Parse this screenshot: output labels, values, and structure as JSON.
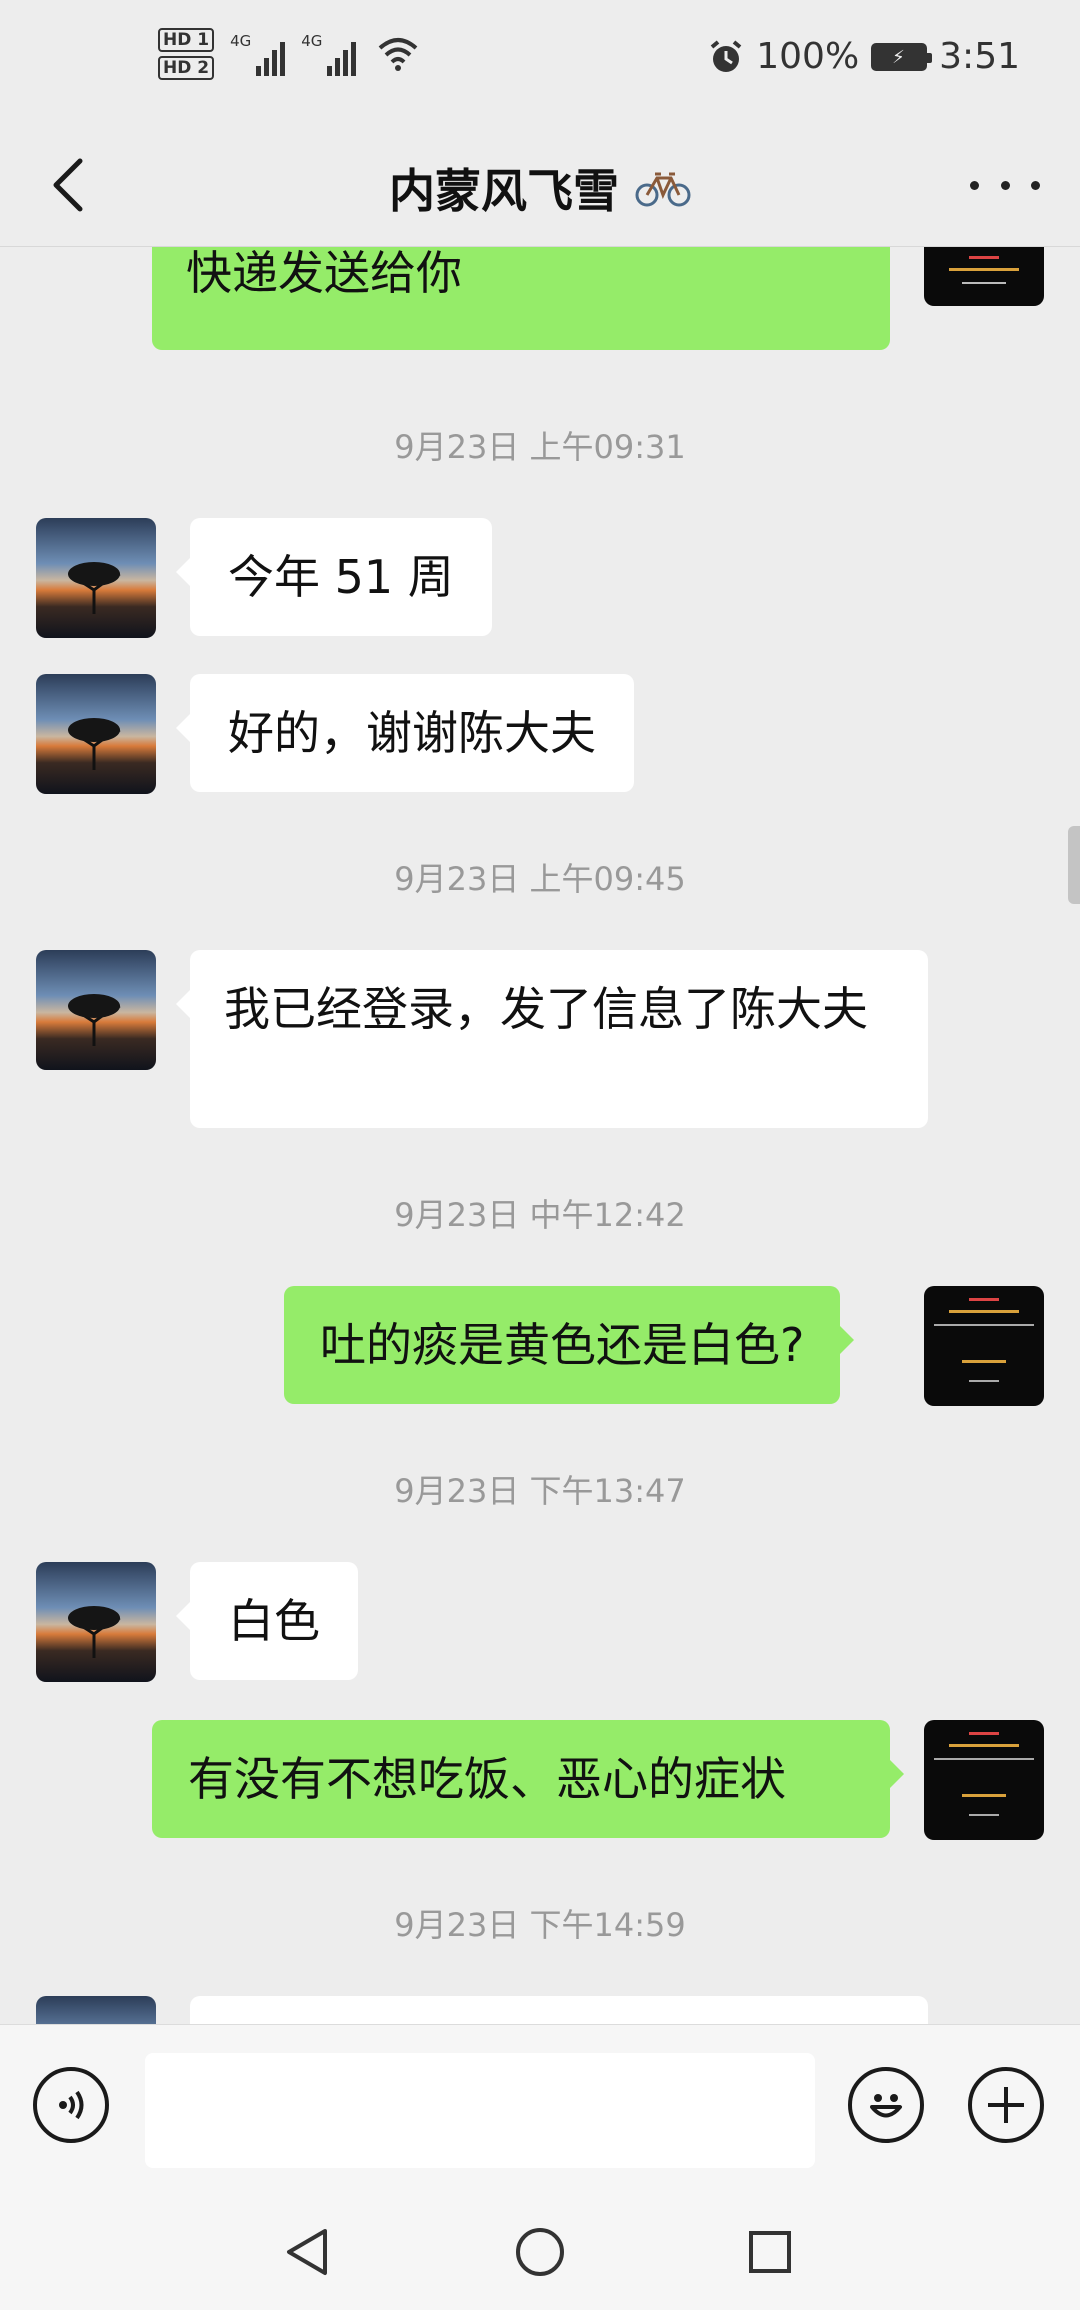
{
  "status_bar": {
    "sim1": "HD 1",
    "sim2": "HD 2",
    "network1": "4G",
    "network2": "4G",
    "battery": "100%",
    "time": "3:51",
    "icons": [
      "alarm-icon",
      "wifi-icon",
      "signal-icon",
      "battery-icon"
    ]
  },
  "header": {
    "title": "内蒙风飞雪",
    "title_icon": "bicycle-icon",
    "back_icon": "back-chevron-icon",
    "more_icon": "more-dots-icon"
  },
  "messages": [
    {
      "type": "text",
      "side": "out",
      "text": "看病后，药物经过百草医生平台快递发送给你"
    },
    {
      "type": "timestamp",
      "text": "9月23日 上午09:31"
    },
    {
      "type": "text",
      "side": "in",
      "text": "今年 51 周"
    },
    {
      "type": "text",
      "side": "in",
      "text": "好的，谢谢陈大夫"
    },
    {
      "type": "timestamp",
      "text": "9月23日 上午09:45"
    },
    {
      "type": "text",
      "side": "in",
      "text": "我已经登录，发了信息了陈大夫"
    },
    {
      "type": "timestamp",
      "text": "9月23日 中午12:42"
    },
    {
      "type": "text",
      "side": "out",
      "text": "吐的痰是黄色还是白色?"
    },
    {
      "type": "timestamp",
      "text": "9月23日 下午13:47"
    },
    {
      "type": "text",
      "side": "in",
      "text": "白色"
    },
    {
      "type": "text",
      "side": "out",
      "text": "有没有不想吃饭、恶心的症状"
    },
    {
      "type": "timestamp",
      "text": "9月23日 下午14:59"
    },
    {
      "type": "text",
      "side": "in",
      "text": ""
    }
  ],
  "input_bar": {
    "value": "",
    "placeholder": "",
    "voice_icon": "voice-icon",
    "emoji_icon": "emoji-icon",
    "plus_icon": "plus-icon"
  },
  "nav_bar": {
    "icons": [
      "nav-back-icon",
      "nav-home-icon",
      "nav-recents-icon"
    ]
  },
  "colors": {
    "background": "#ededed",
    "outgoing_bubble": "#95ec69",
    "incoming_bubble": "#ffffff",
    "timestamp": "#999999"
  }
}
